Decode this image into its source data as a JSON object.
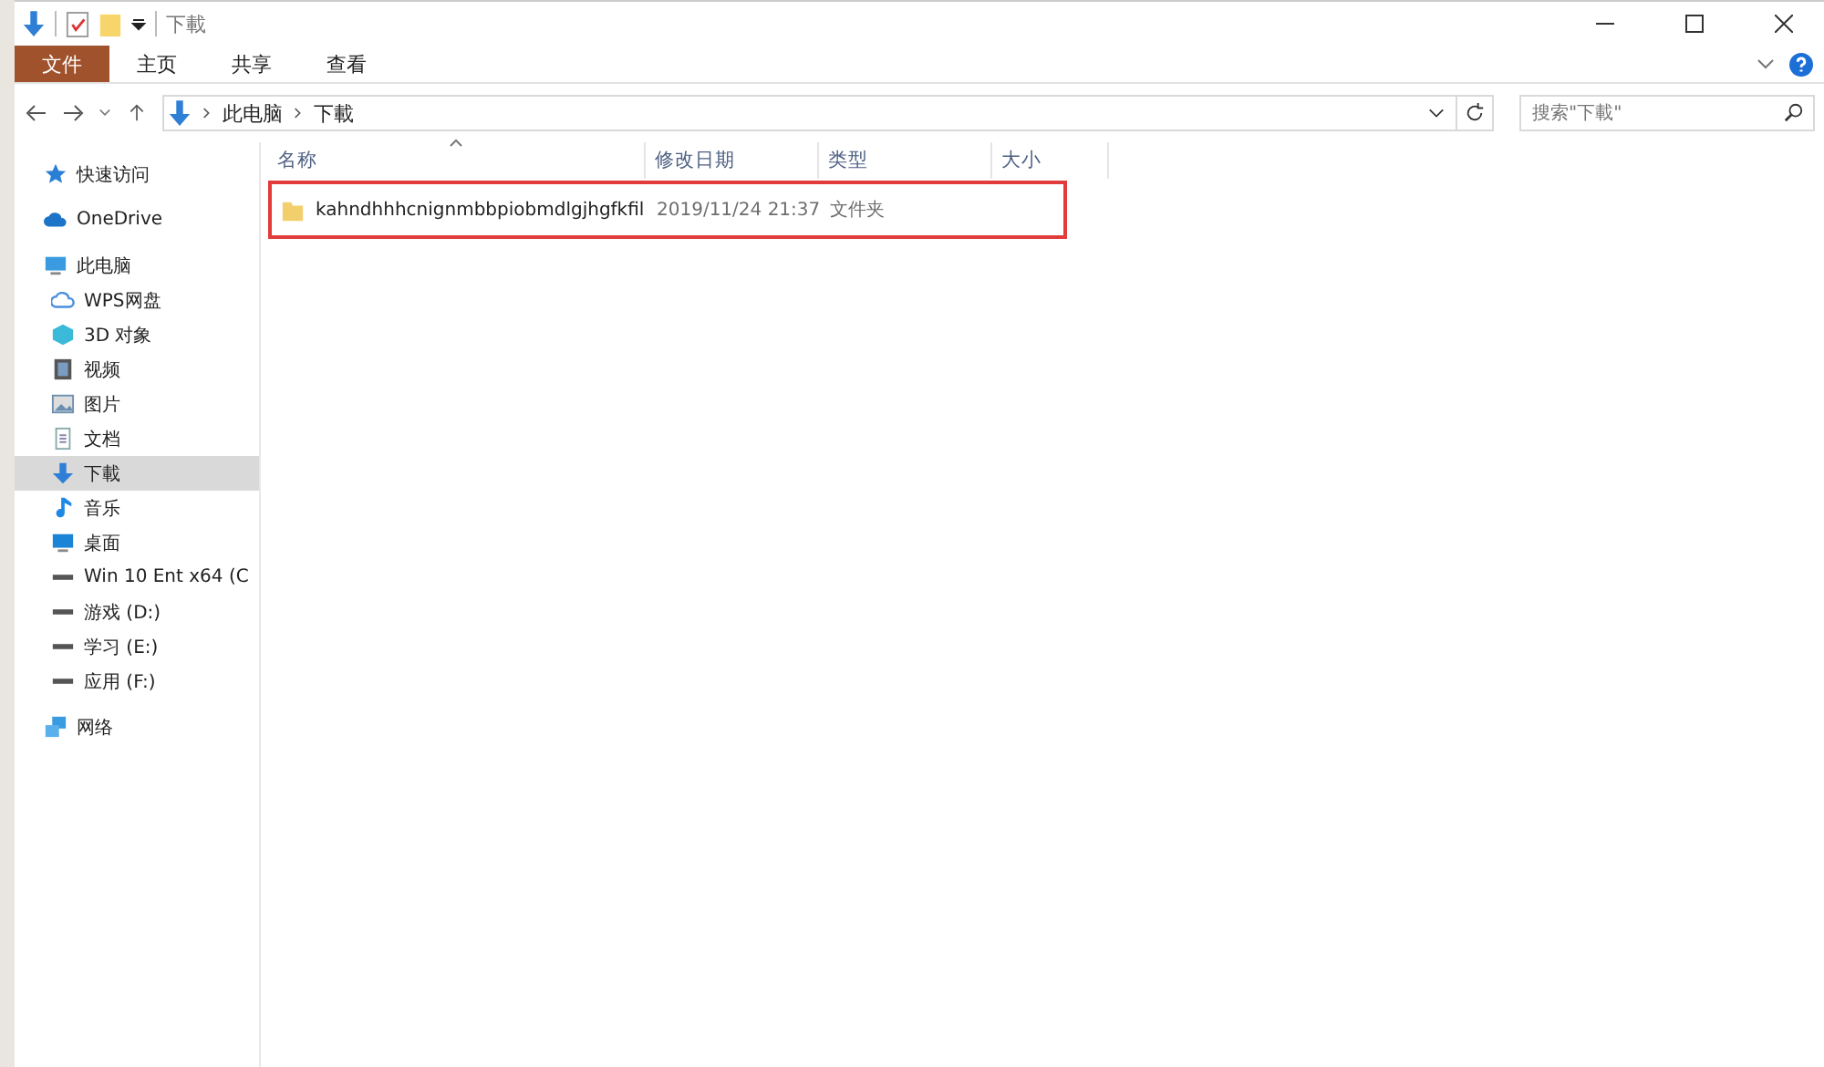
{
  "window": {
    "title": "下載"
  },
  "ribbon_tabs": [
    {
      "label": "文件",
      "selected": true
    },
    {
      "label": "主页",
      "selected": false
    },
    {
      "label": "共享",
      "selected": false
    },
    {
      "label": "查看",
      "selected": false
    }
  ],
  "address": {
    "path": [
      "此电脑",
      "下載"
    ]
  },
  "search": {
    "placeholder": "搜索\"下載\""
  },
  "sidebar": {
    "items": [
      {
        "label": "快速访问",
        "kind": "star",
        "selected": false
      },
      {
        "label": "OneDrive",
        "kind": "cloud",
        "selected": false
      },
      {
        "label": "此电脑",
        "kind": "pc",
        "selected": false,
        "children": [
          {
            "label": "WPS网盘",
            "kind": "cloud-outline",
            "selected": false
          },
          {
            "label": "3D 对象",
            "kind": "cube",
            "selected": false
          },
          {
            "label": "视频",
            "kind": "video",
            "selected": false
          },
          {
            "label": "图片",
            "kind": "image",
            "selected": false
          },
          {
            "label": "文档",
            "kind": "doc",
            "selected": false
          },
          {
            "label": "下載",
            "kind": "download",
            "selected": true
          },
          {
            "label": "音乐",
            "kind": "music",
            "selected": false
          },
          {
            "label": "桌面",
            "kind": "desktop",
            "selected": false
          },
          {
            "label": "Win 10 Ent x64 (C",
            "kind": "drive",
            "selected": false
          },
          {
            "label": "游戏 (D:)",
            "kind": "drive",
            "selected": false
          },
          {
            "label": "学习 (E:)",
            "kind": "drive",
            "selected": false
          },
          {
            "label": "应用 (F:)",
            "kind": "drive",
            "selected": false
          }
        ]
      },
      {
        "label": "网络",
        "kind": "network",
        "selected": false
      }
    ]
  },
  "table": {
    "columns": [
      "名称",
      "修改日期",
      "类型",
      "大小"
    ],
    "rows": [
      {
        "name": "kahndhhhcnignmbbpiobmdlgjhgfkfil",
        "modified": "2019/11/24 21:37",
        "type": "文件夹",
        "highlighted": true
      }
    ]
  }
}
